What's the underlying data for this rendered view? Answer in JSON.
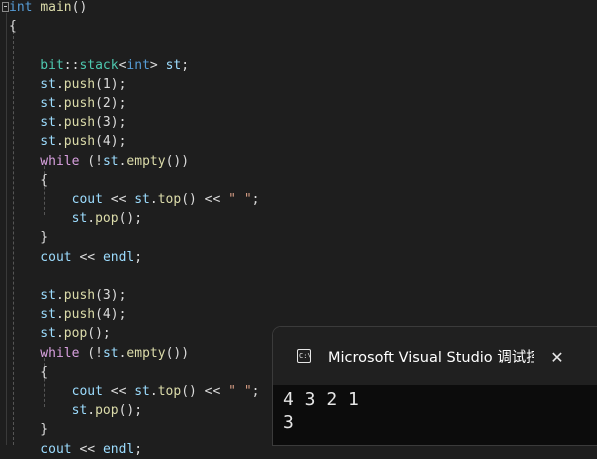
{
  "editor": {
    "lines": [
      [
        {
          "t": "int",
          "c": "kw"
        },
        {
          "t": " ",
          "c": "pl"
        },
        {
          "t": "main",
          "c": "fn"
        },
        {
          "t": "()",
          "c": "pl"
        }
      ],
      [
        {
          "t": "{",
          "c": "pl"
        }
      ],
      [],
      [
        {
          "t": "    bit",
          "c": "ty"
        },
        {
          "t": "::",
          "c": "pl"
        },
        {
          "t": "stack",
          "c": "ty"
        },
        {
          "t": "<",
          "c": "pl"
        },
        {
          "t": "int",
          "c": "kw"
        },
        {
          "t": "> ",
          "c": "pl"
        },
        {
          "t": "st",
          "c": "var"
        },
        {
          "t": ";",
          "c": "pl"
        }
      ],
      [
        {
          "t": "    st",
          "c": "var"
        },
        {
          "t": ".",
          "c": "pl"
        },
        {
          "t": "push",
          "c": "fn"
        },
        {
          "t": "(1);",
          "c": "pl"
        }
      ],
      [
        {
          "t": "    st",
          "c": "var"
        },
        {
          "t": ".",
          "c": "pl"
        },
        {
          "t": "push",
          "c": "fn"
        },
        {
          "t": "(2);",
          "c": "pl"
        }
      ],
      [
        {
          "t": "    st",
          "c": "var"
        },
        {
          "t": ".",
          "c": "pl"
        },
        {
          "t": "push",
          "c": "fn"
        },
        {
          "t": "(3);",
          "c": "pl"
        }
      ],
      [
        {
          "t": "    st",
          "c": "var"
        },
        {
          "t": ".",
          "c": "pl"
        },
        {
          "t": "push",
          "c": "fn"
        },
        {
          "t": "(4);",
          "c": "pl"
        }
      ],
      [
        {
          "t": "    while",
          "c": "ctl"
        },
        {
          "t": " (!",
          "c": "pl"
        },
        {
          "t": "st",
          "c": "var"
        },
        {
          "t": ".",
          "c": "pl"
        },
        {
          "t": "empty",
          "c": "fn"
        },
        {
          "t": "())",
          "c": "pl"
        }
      ],
      [
        {
          "t": "    {",
          "c": "pl"
        }
      ],
      [
        {
          "t": "        cout",
          "c": "var"
        },
        {
          "t": " << ",
          "c": "pl"
        },
        {
          "t": "st",
          "c": "var"
        },
        {
          "t": ".",
          "c": "pl"
        },
        {
          "t": "top",
          "c": "fn"
        },
        {
          "t": "() << ",
          "c": "pl"
        },
        {
          "t": "\" \"",
          "c": "str"
        },
        {
          "t": ";",
          "c": "pl"
        }
      ],
      [
        {
          "t": "        st",
          "c": "var"
        },
        {
          "t": ".",
          "c": "pl"
        },
        {
          "t": "pop",
          "c": "fn"
        },
        {
          "t": "();",
          "c": "pl"
        }
      ],
      [
        {
          "t": "    }",
          "c": "pl"
        }
      ],
      [
        {
          "t": "    cout",
          "c": "var"
        },
        {
          "t": " << ",
          "c": "pl"
        },
        {
          "t": "endl",
          "c": "var"
        },
        {
          "t": ";",
          "c": "pl"
        }
      ],
      [],
      [
        {
          "t": "    st",
          "c": "var"
        },
        {
          "t": ".",
          "c": "pl"
        },
        {
          "t": "push",
          "c": "fn"
        },
        {
          "t": "(3);",
          "c": "pl"
        }
      ],
      [
        {
          "t": "    st",
          "c": "var"
        },
        {
          "t": ".",
          "c": "pl"
        },
        {
          "t": "push",
          "c": "fn"
        },
        {
          "t": "(4);",
          "c": "pl"
        }
      ],
      [
        {
          "t": "    st",
          "c": "var"
        },
        {
          "t": ".",
          "c": "pl"
        },
        {
          "t": "pop",
          "c": "fn"
        },
        {
          "t": "();",
          "c": "pl"
        }
      ],
      [
        {
          "t": "    while",
          "c": "ctl"
        },
        {
          "t": " (!",
          "c": "pl"
        },
        {
          "t": "st",
          "c": "var"
        },
        {
          "t": ".",
          "c": "pl"
        },
        {
          "t": "empty",
          "c": "fn"
        },
        {
          "t": "())",
          "c": "pl"
        }
      ],
      [
        {
          "t": "    {",
          "c": "pl"
        }
      ],
      [
        {
          "t": "        cout",
          "c": "var"
        },
        {
          "t": " << ",
          "c": "pl"
        },
        {
          "t": "st",
          "c": "var"
        },
        {
          "t": ".",
          "c": "pl"
        },
        {
          "t": "top",
          "c": "fn"
        },
        {
          "t": "() << ",
          "c": "pl"
        },
        {
          "t": "\" \"",
          "c": "str"
        },
        {
          "t": ";",
          "c": "pl"
        }
      ],
      [
        {
          "t": "        st",
          "c": "var"
        },
        {
          "t": ".",
          "c": "pl"
        },
        {
          "t": "pop",
          "c": "fn"
        },
        {
          "t": "();",
          "c": "pl"
        }
      ],
      [
        {
          "t": "    }",
          "c": "pl"
        }
      ],
      [
        {
          "t": "    cout",
          "c": "var"
        },
        {
          "t": " << ",
          "c": "pl"
        },
        {
          "t": "endl",
          "c": "var"
        },
        {
          "t": ";",
          "c": "pl"
        }
      ]
    ]
  },
  "console": {
    "icon": "console-app-icon",
    "icon_text": "C:\\",
    "title": "Microsoft Visual Studio 调试控制台",
    "close_label": "✕",
    "output": [
      "4 3 2 1",
      "3"
    ]
  },
  "colors": {
    "editor_bg": "#1e1e1e",
    "keyword": "#569cd6",
    "control": "#d8a0df",
    "function": "#dcdcaa",
    "variable": "#9cdcfe",
    "type": "#4ec9b0",
    "string": "#d69d85",
    "console_bg": "#0c0c0c",
    "console_title_bg": "#202020"
  }
}
